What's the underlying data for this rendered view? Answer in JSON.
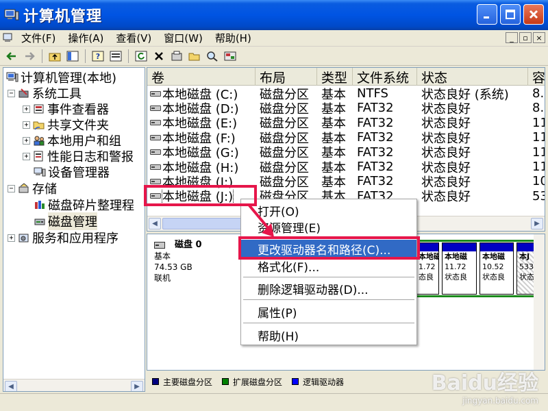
{
  "window": {
    "title": "计算机管理",
    "colors": {
      "titlebar": "#0054e3",
      "selection": "#316ac5",
      "callout": "#e6164a"
    }
  },
  "menubar": {
    "items": [
      "文件(F)",
      "操作(A)",
      "查看(V)",
      "窗口(W)",
      "帮助(H)"
    ]
  },
  "toolbar": {
    "icons": [
      "back-arrow-icon",
      "forward-arrow-icon",
      "up-folder-icon",
      "show-tree-icon",
      "help-icon",
      "properties-icon",
      "refresh-icon",
      "delete-icon",
      "settings-icon",
      "open-folder-icon",
      "search-icon",
      "export-icon"
    ]
  },
  "tree": {
    "root": "计算机管理(本地)",
    "system_tools": "系统工具",
    "event_viewer": "事件查看器",
    "shared_folders": "共享文件夹",
    "local_users": "本地用户和组",
    "perf_logs": "性能日志和警报",
    "device_manager": "设备管理器",
    "storage": "存储",
    "defrag": "磁盘碎片整理程",
    "disk_mgmt": "磁盘管理",
    "services": "服务和应用程序"
  },
  "volume_list": {
    "headers": [
      "卷",
      "布局",
      "类型",
      "文件系统",
      "状态",
      "容"
    ],
    "rows": [
      {
        "vol": "本地磁盘 (C:)",
        "layout": "磁盘分区",
        "type": "基本",
        "fs": "NTFS",
        "status": "状态良好 (系统)",
        "cap": "8."
      },
      {
        "vol": "本地磁盘 (D:)",
        "layout": "磁盘分区",
        "type": "基本",
        "fs": "FAT32",
        "status": "状态良好",
        "cap": "8."
      },
      {
        "vol": "本地磁盘 (E:)",
        "layout": "磁盘分区",
        "type": "基本",
        "fs": "FAT32",
        "status": "状态良好",
        "cap": "11"
      },
      {
        "vol": "本地磁盘 (F:)",
        "layout": "磁盘分区",
        "type": "基本",
        "fs": "FAT32",
        "status": "状态良好",
        "cap": "11"
      },
      {
        "vol": "本地磁盘 (G:)",
        "layout": "磁盘分区",
        "type": "基本",
        "fs": "FAT32",
        "status": "状态良好",
        "cap": "11"
      },
      {
        "vol": "本地磁盘 (H:)",
        "layout": "磁盘分区",
        "type": "基本",
        "fs": "FAT32",
        "status": "状态良好",
        "cap": "11"
      },
      {
        "vol": "本地磁盘 (I:)",
        "layout": "磁盘分区",
        "type": "基本",
        "fs": "FAT32",
        "status": "状态良好",
        "cap": "10"
      },
      {
        "vol": "本地磁盘 (J:)",
        "layout": "磁盘分区",
        "type": "基本",
        "fs": "FAT32",
        "status": "状态良好",
        "cap": "53"
      }
    ]
  },
  "disk_graph": {
    "disk_name": "磁盘 0",
    "disk_type": "基本",
    "disk_size": "74.53 GB",
    "disk_status": "联机",
    "segments": [
      {
        "name": "本地磁",
        "size": "1.72",
        "status": "态良"
      },
      {
        "name": "本地磁",
        "size": "11.72",
        "status": "状态良"
      },
      {
        "name": "本地磁",
        "size": "10.52",
        "status": "状态良"
      },
      {
        "name": "本J",
        "size": "533",
        "status": "状态"
      }
    ]
  },
  "legend": {
    "items": [
      {
        "label": "主要磁盘分区",
        "color": "#000080"
      },
      {
        "label": "扩展磁盘分区",
        "color": "#008000"
      },
      {
        "label": "逻辑驱动器",
        "color": "#0000ff"
      }
    ]
  },
  "context_menu": {
    "open": "打开(O)",
    "explore": "资源管理(E)",
    "change_letter": "更改驱动器名和路径(C)...",
    "format": "格式化(F)...",
    "delete": "删除逻辑驱动器(D)...",
    "properties": "属性(P)",
    "help": "帮助(H)"
  },
  "watermark": {
    "logo": "Baidu经验",
    "url": "jingyan.baidu.com"
  }
}
